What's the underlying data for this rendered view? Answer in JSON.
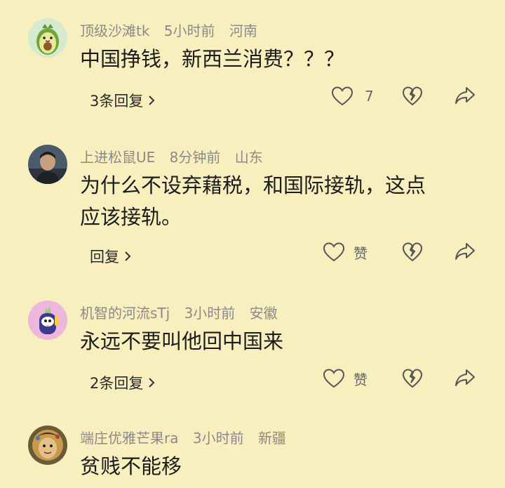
{
  "comments": [
    {
      "username": "顶级沙滩tk",
      "time": "5小时前",
      "location": "河南",
      "text_lines": [
        "中国挣钱，新西兰消费？？？"
      ],
      "reply_label": "3条回复",
      "like_label": "7",
      "avatar_icon": "avocado-avatar"
    },
    {
      "username": "上进松鼠UE",
      "time": "8分钟前",
      "location": "山东",
      "text_lines": [
        "为什么不设弃藉税，和国际接轨，这点",
        "应该接轨。"
      ],
      "reply_label": "回复",
      "like_label": "赞",
      "avatar_icon": "man-photo-avatar"
    },
    {
      "username": "机智的河流sTj",
      "time": "3小时前",
      "location": "安徽",
      "text_lines": [
        "永远不要叫他回中国来"
      ],
      "reply_label": "2条回复",
      "like_label": "赞",
      "avatar_icon": "cartoon-bird-avatar"
    },
    {
      "username": "端庄优雅芒果ra",
      "time": "3小时前",
      "location": "新疆",
      "text_lines": [
        "贫贱不能移"
      ],
      "reply_label": "",
      "like_label": "",
      "avatar_icon": "painted-face-avatar"
    }
  ],
  "colors": {
    "background": "#f8efbf",
    "meta_text": "#8a8a8a",
    "body_text": "#1c1c1c"
  },
  "icons": [
    "heart-icon",
    "broken-heart-icon",
    "share-icon",
    "chevron-right-icon"
  ]
}
